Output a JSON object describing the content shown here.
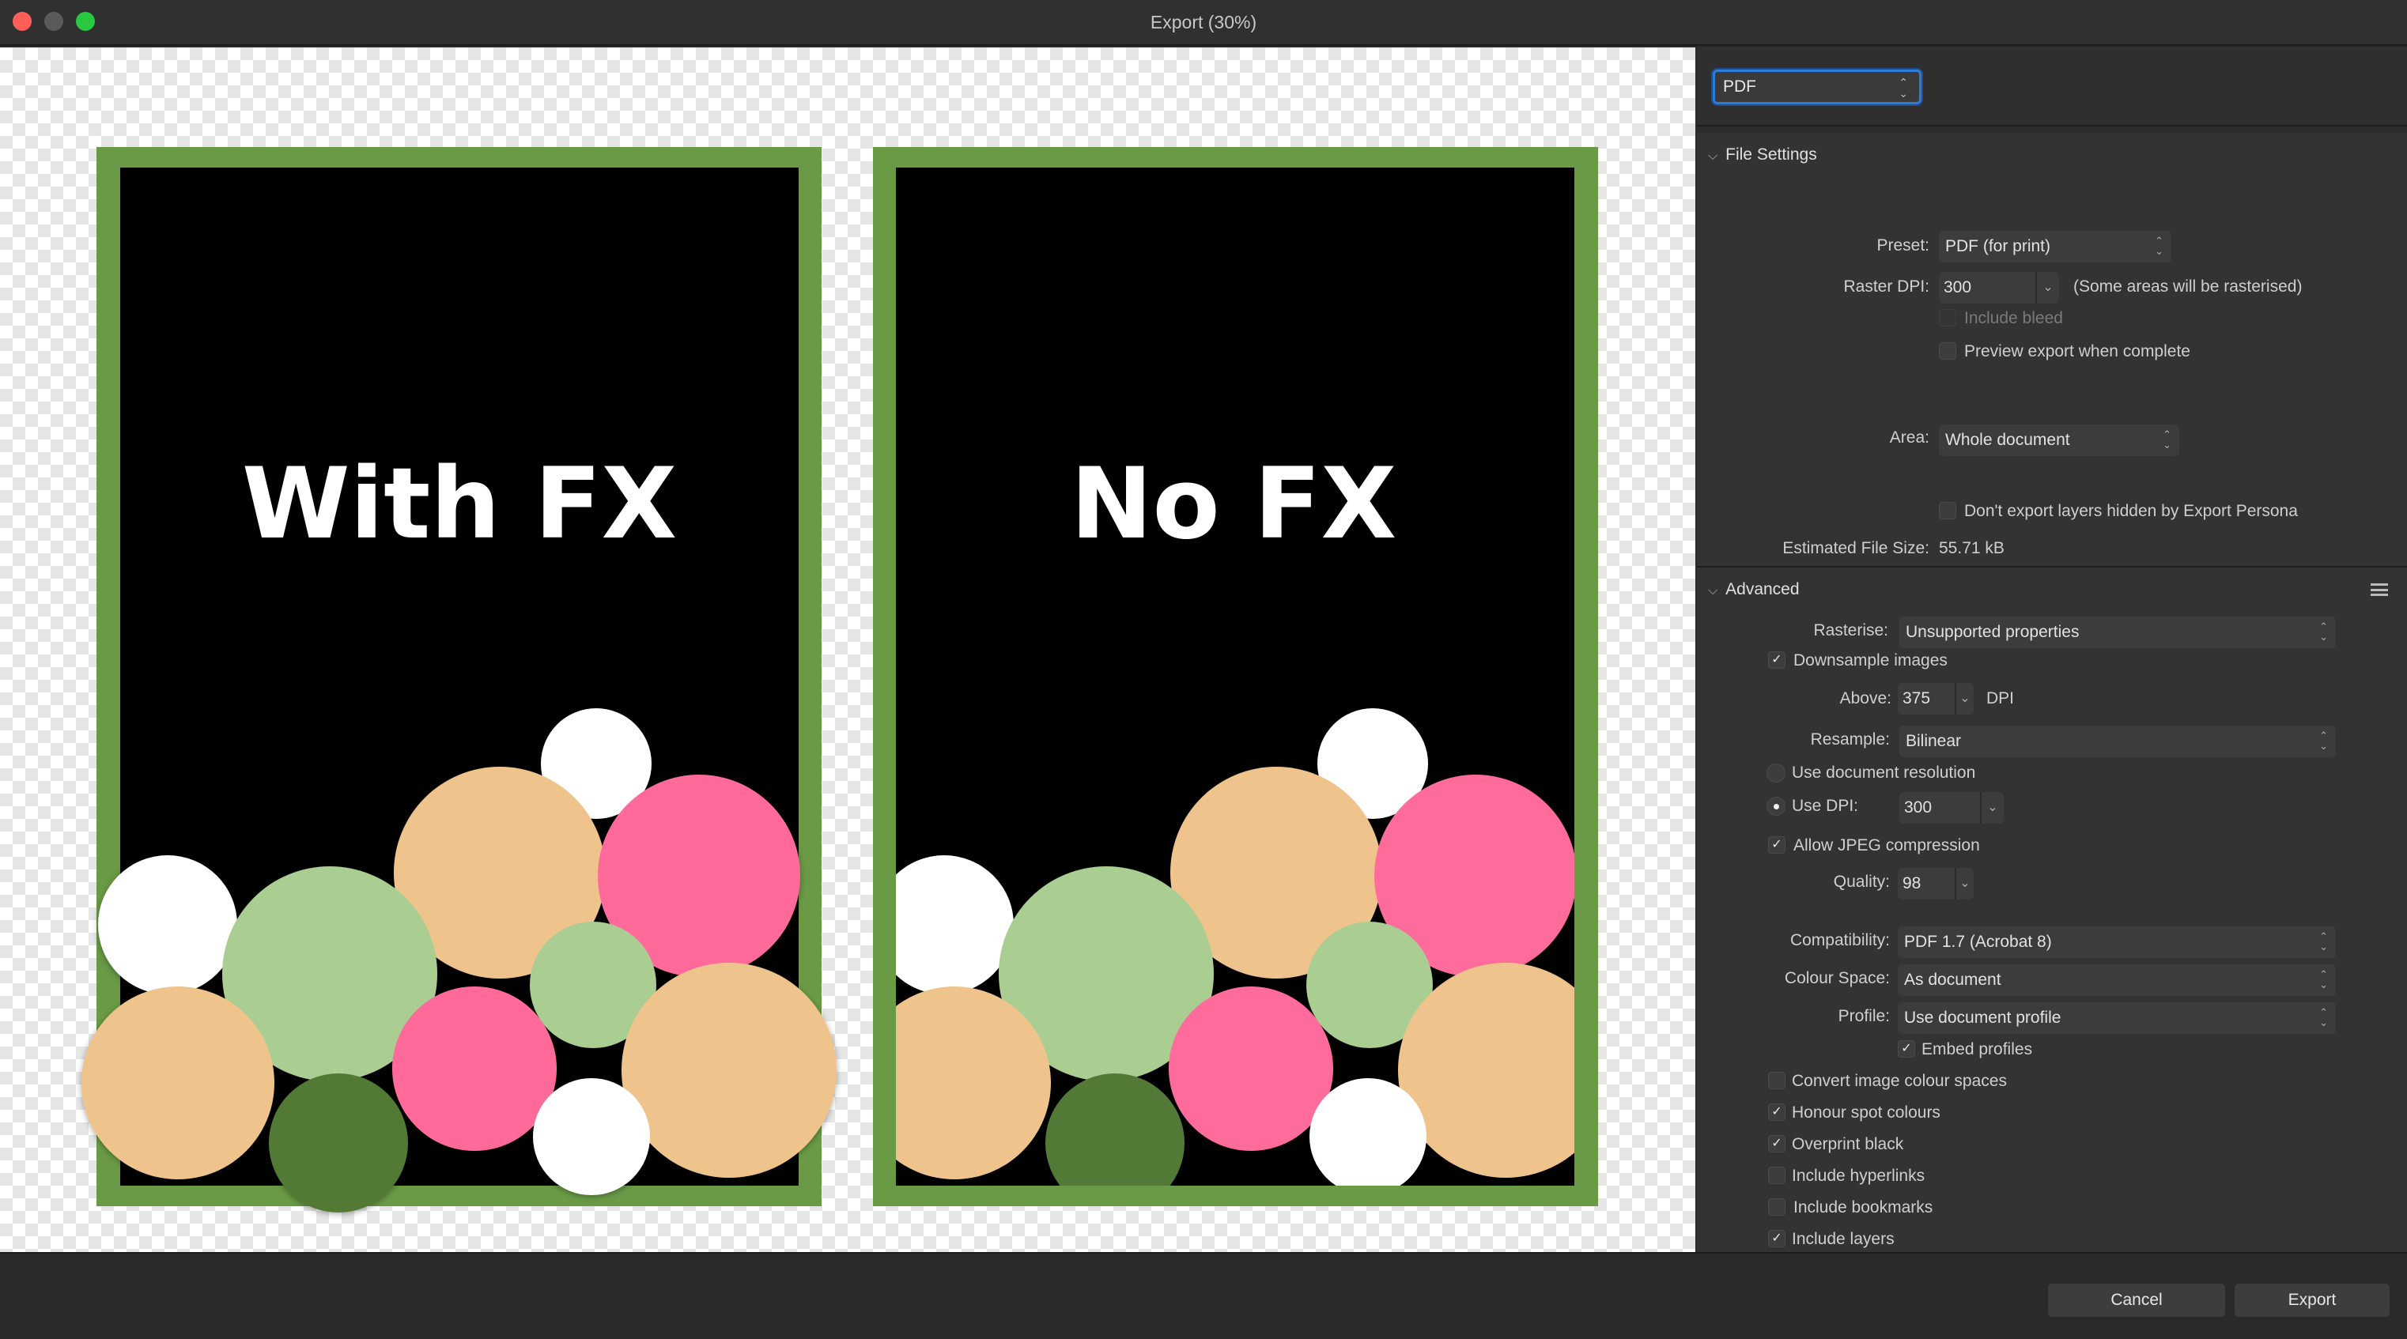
{
  "window": {
    "title": "Export (30%)"
  },
  "preview": {
    "artboards": [
      {
        "label": "With FX"
      },
      {
        "label": "No FX"
      }
    ],
    "colors": {
      "frame": "#6a9a45",
      "artboard_bg": "#000000",
      "peach": "#efc38c",
      "sage": "#aacd92",
      "pink": "#ff6b9b",
      "white": "#ffffff",
      "dark_green": "#527a36"
    }
  },
  "format": {
    "value": "PDF"
  },
  "file_settings": {
    "header": "File Settings",
    "preset_label": "Preset:",
    "preset_value": "PDF (for print)",
    "raster_dpi_label": "Raster DPI:",
    "raster_dpi_value": "300",
    "raster_note": "(Some areas will be rasterised)",
    "include_bleed": "Include bleed",
    "preview_export": "Preview export when complete",
    "area_label": "Area:",
    "area_value": "Whole document",
    "dont_export_hidden": "Don't export layers hidden by Export Persona",
    "estimated_size_label": "Estimated File Size:",
    "estimated_size_value": "55.71 kB"
  },
  "advanced": {
    "header": "Advanced",
    "rasterise_label": "Rasterise:",
    "rasterise_value": "Unsupported properties",
    "downsample_images": "Downsample images",
    "above_label": "Above:",
    "above_value": "375",
    "dpi_unit": "DPI",
    "resample_label": "Resample:",
    "resample_value": "Bilinear",
    "use_doc_resolution": "Use document resolution",
    "use_dpi_label": "Use DPI:",
    "use_dpi_value": "300",
    "allow_jpeg": "Allow JPEG compression",
    "quality_label": "Quality:",
    "quality_value": "98",
    "compatibility_label": "Compatibility:",
    "compatibility_value": "PDF 1.7 (Acrobat 8)",
    "colour_space_label": "Colour Space:",
    "colour_space_value": "As document",
    "profile_label": "Profile:",
    "profile_value": "Use document profile",
    "embed_profiles": "Embed profiles",
    "convert_image_colour": "Convert image colour spaces",
    "honour_spot": "Honour spot colours",
    "overprint_black": "Overprint black",
    "include_hyperlinks": "Include hyperlinks",
    "include_bookmarks": "Include bookmarks",
    "include_layers": "Include layers"
  },
  "buttons": {
    "cancel": "Cancel",
    "export": "Export"
  }
}
